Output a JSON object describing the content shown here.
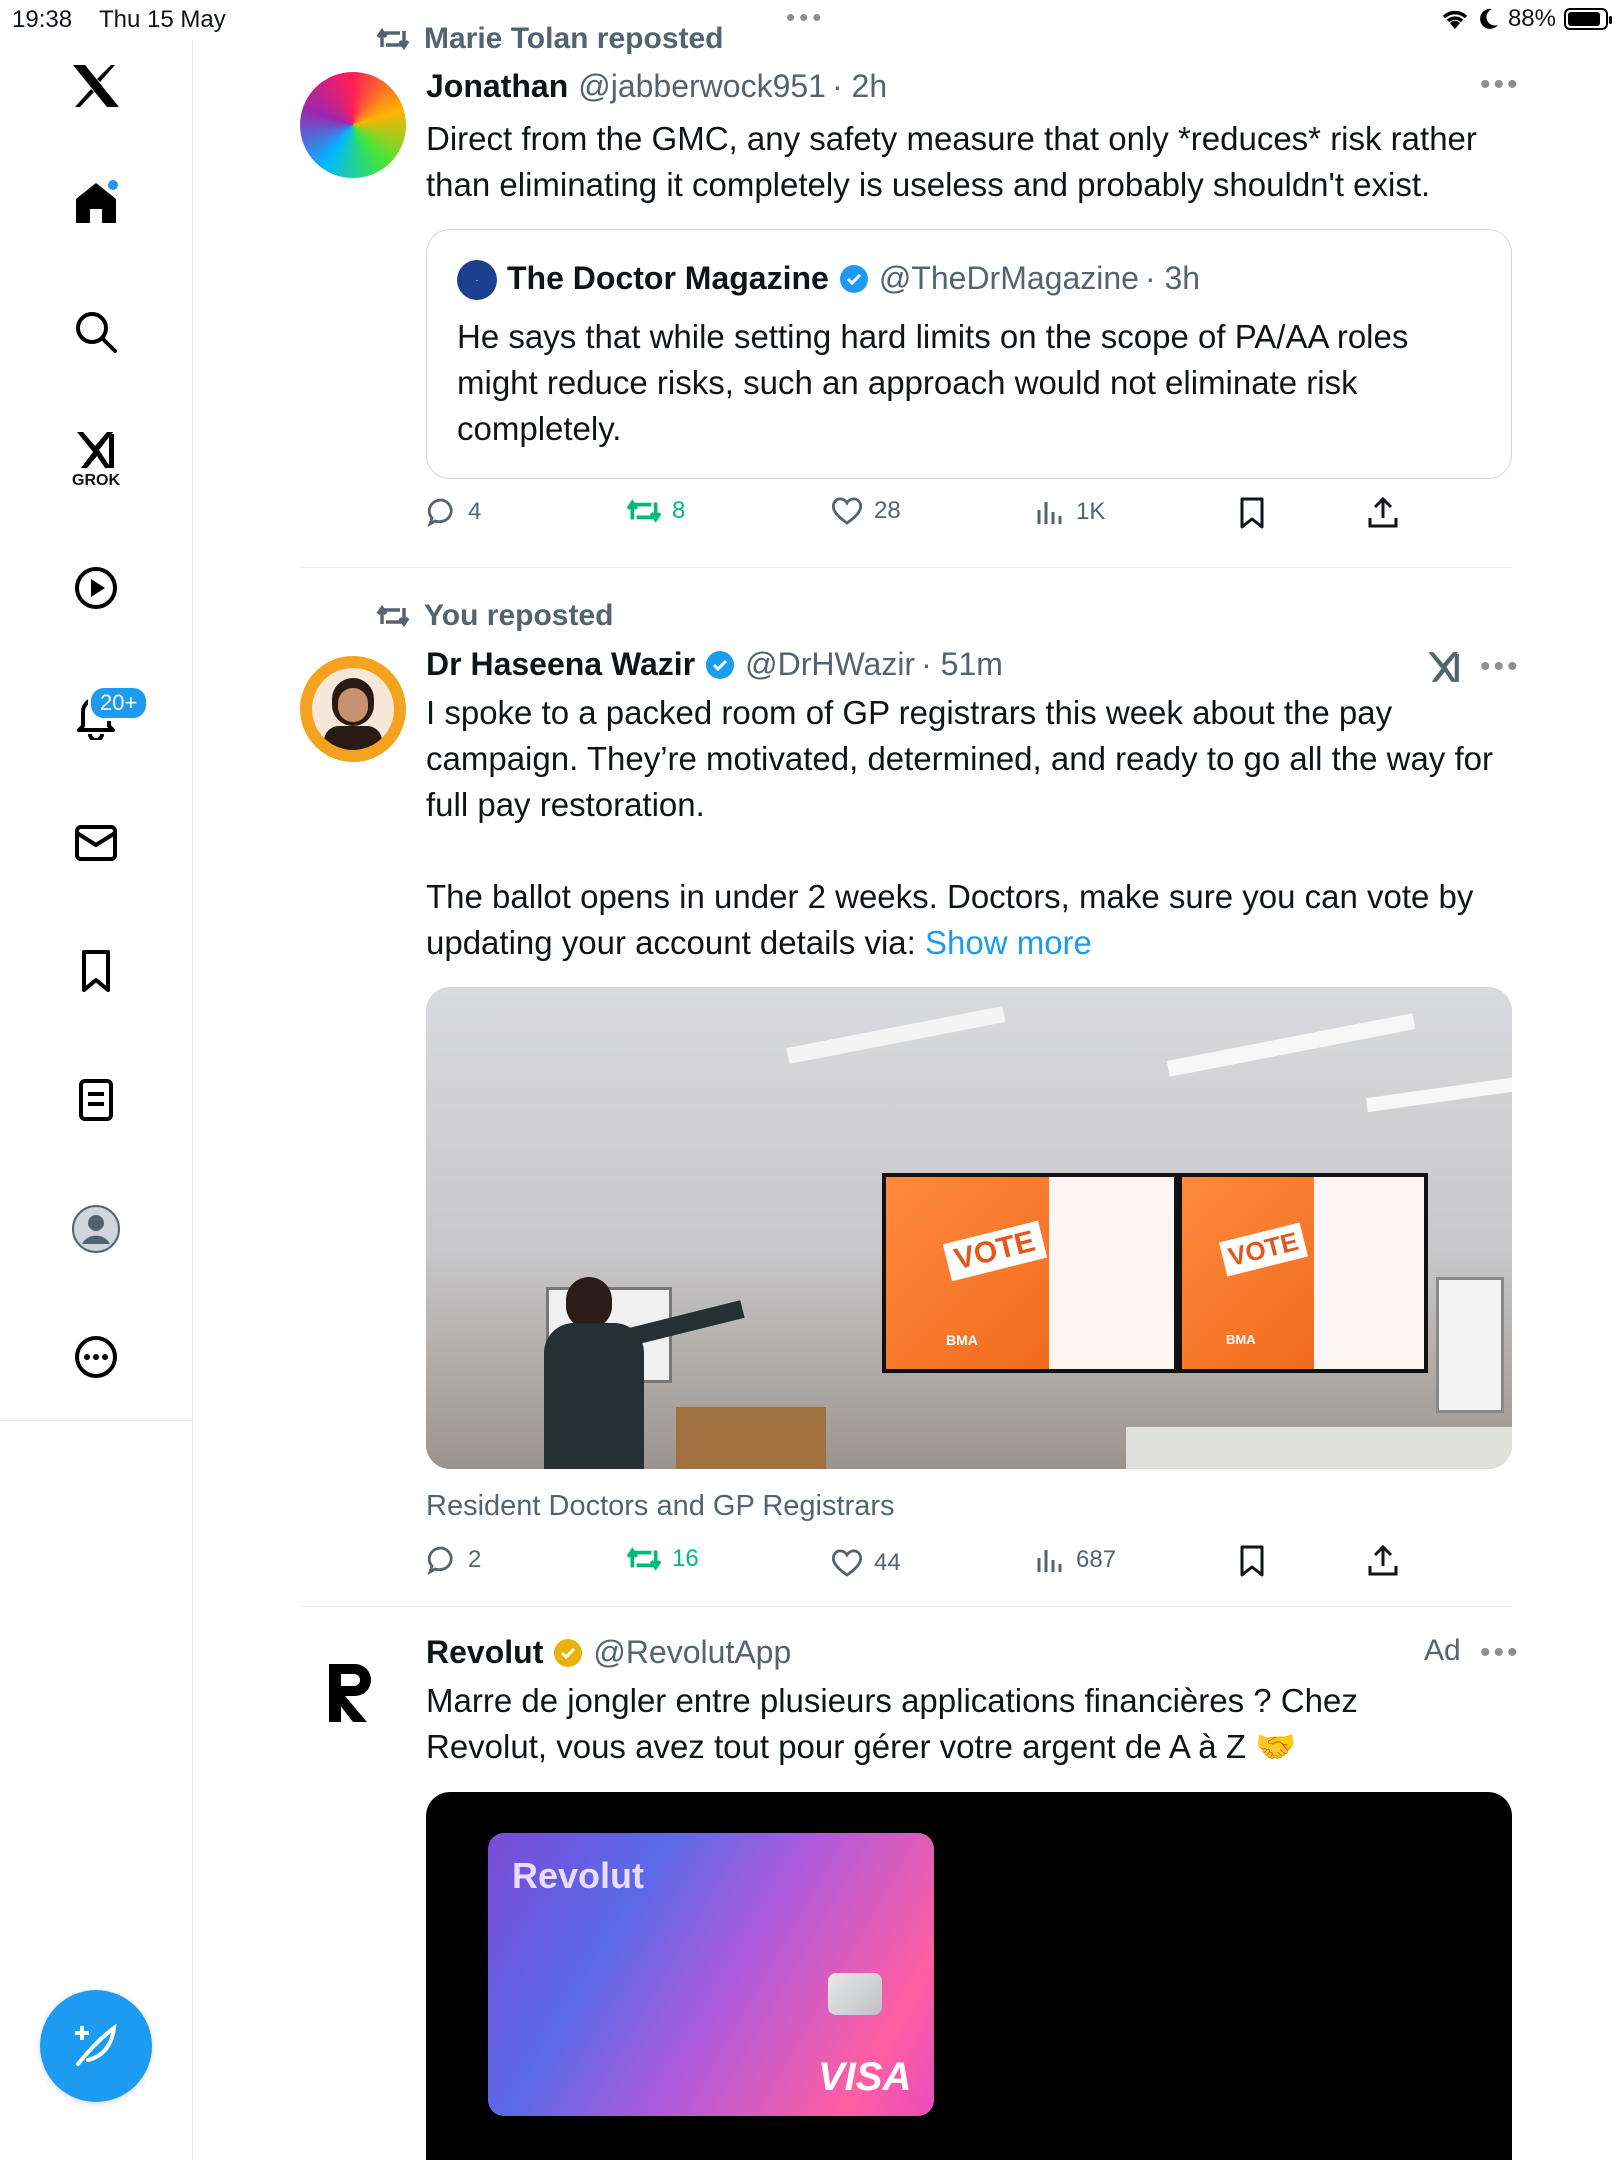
{
  "status_bar": {
    "time": "19:38",
    "date": "Thu 15 May",
    "battery": "88%",
    "battery_level": 0.88
  },
  "sidebar": {
    "notifications_badge": "20+",
    "grok_label": "GROK"
  },
  "tweets": [
    {
      "repost_label": "Marie Tolan reposted",
      "name": "Jonathan",
      "handle": "@jabberwock951",
      "time": "· 2h",
      "text": "Direct from the GMC, any safety measure that only *reduces* risk rather than eliminating it completely is useless and probably shouldn't exist.",
      "quote": {
        "name": "The Doctor Magazine",
        "handle": "@TheDrMagazine",
        "time": "· 3h",
        "text": "He says that while setting hard limits on the scope of PA/AA roles might reduce risks, such an approach would not eliminate risk completely."
      },
      "stats": {
        "replies": "4",
        "reposts": "8",
        "likes": "28",
        "views": "1K"
      }
    },
    {
      "repost_label": "You reposted",
      "name": "Dr Haseena Wazir",
      "handle": "@DrHWazir",
      "time": "· 51m",
      "text_1": "I spoke to a packed room of GP registrars this week about the pay campaign. They’re motivated, determined, and ready to go all the way for full pay restoration.",
      "text_2": "The ballot opens in under 2 weeks. Doctors, make sure you can vote by updating your account details via: ",
      "show_more": "Show more",
      "media_caption": "Resident Doctors and GP Registrars",
      "screen_text": {
        "vote": "VOTE",
        "bma": "BMA"
      },
      "stats": {
        "replies": "2",
        "reposts": "16",
        "likes": "44",
        "views": "687"
      }
    },
    {
      "name": "Revolut",
      "handle": "@RevolutApp",
      "ad_label": "Ad",
      "text": "Marre de jongler entre plusieurs applications financières ? Chez Revolut, vous avez tout pour gérer votre argent de A à Z 🤝",
      "card_brand": "Revolut",
      "card_network": "VISA"
    }
  ],
  "colors": {
    "accent": "#1d9bf0",
    "repost_green": "#00ba7c",
    "secondary_text": "#536471",
    "gold_badge": "#e8b10b"
  }
}
